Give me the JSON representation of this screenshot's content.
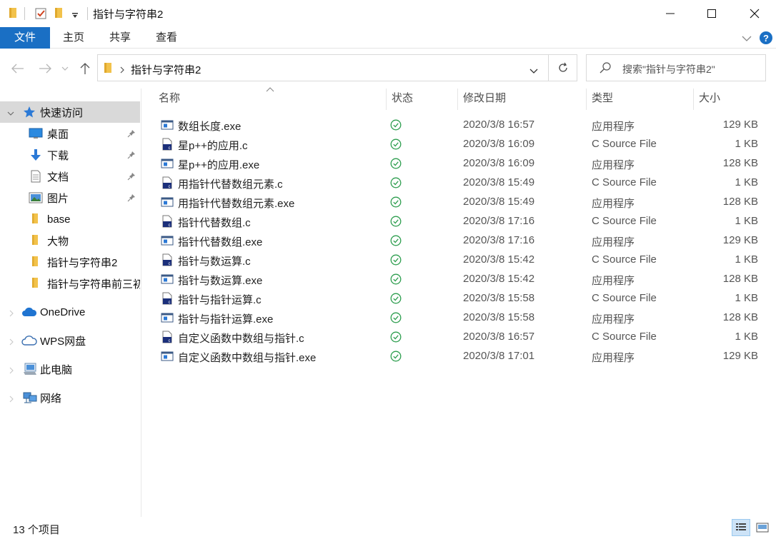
{
  "window": {
    "title": "指针与字符串2"
  },
  "ribbon": {
    "tabs": [
      {
        "label": "文件",
        "active": true
      },
      {
        "label": "主页",
        "active": false
      },
      {
        "label": "共享",
        "active": false
      },
      {
        "label": "查看",
        "active": false
      }
    ]
  },
  "address": {
    "path": "指针与字符串2",
    "search_placeholder": "搜索\"指针与字符串2\""
  },
  "sidebar": {
    "items": [
      {
        "label": "快速访问",
        "icon": "star-icon",
        "pinned": false,
        "selected": true
      },
      {
        "label": "桌面",
        "icon": "desktop-icon",
        "pinned": true
      },
      {
        "label": "下载",
        "icon": "download-icon",
        "pinned": true
      },
      {
        "label": "文档",
        "icon": "document-icon",
        "pinned": true
      },
      {
        "label": "图片",
        "icon": "picture-icon",
        "pinned": true
      },
      {
        "label": "base",
        "icon": "folder-icon",
        "pinned": false
      },
      {
        "label": "大物",
        "icon": "folder-icon",
        "pinned": false
      },
      {
        "label": "指针与字符串2",
        "icon": "folder-icon",
        "pinned": false
      },
      {
        "label": "指针与字符串前三初",
        "icon": "folder-icon",
        "pinned": false
      },
      {
        "label": "OneDrive",
        "icon": "cloud-icon",
        "pinned": false
      },
      {
        "label": "WPS网盘",
        "icon": "wps-cloud-icon",
        "pinned": false
      },
      {
        "label": "此电脑",
        "icon": "computer-icon",
        "pinned": false
      },
      {
        "label": "网络",
        "icon": "network-icon",
        "pinned": false
      }
    ]
  },
  "columns": {
    "name": "名称",
    "status": "状态",
    "modified": "修改日期",
    "type": "类型",
    "size": "大小"
  },
  "files": [
    {
      "name": "数组长度.exe",
      "kind": "exe",
      "date": "2020/3/8 16:57",
      "type": "应用程序",
      "size": "129 KB"
    },
    {
      "name": "星p++的应用.c",
      "kind": "c",
      "date": "2020/3/8 16:09",
      "type": "C Source File",
      "size": "1 KB"
    },
    {
      "name": "星p++的应用.exe",
      "kind": "exe",
      "date": "2020/3/8 16:09",
      "type": "应用程序",
      "size": "128 KB"
    },
    {
      "name": "用指针代替数组元素.c",
      "kind": "c",
      "date": "2020/3/8 15:49",
      "type": "C Source File",
      "size": "1 KB"
    },
    {
      "name": "用指针代替数组元素.exe",
      "kind": "exe",
      "date": "2020/3/8 15:49",
      "type": "应用程序",
      "size": "128 KB"
    },
    {
      "name": "指针代替数组.c",
      "kind": "c",
      "date": "2020/3/8 17:16",
      "type": "C Source File",
      "size": "1 KB"
    },
    {
      "name": "指针代替数组.exe",
      "kind": "exe",
      "date": "2020/3/8 17:16",
      "type": "应用程序",
      "size": "129 KB"
    },
    {
      "name": "指针与数运算.c",
      "kind": "c",
      "date": "2020/3/8 15:42",
      "type": "C Source File",
      "size": "1 KB"
    },
    {
      "name": "指针与数运算.exe",
      "kind": "exe",
      "date": "2020/3/8 15:42",
      "type": "应用程序",
      "size": "128 KB"
    },
    {
      "name": "指针与指针运算.c",
      "kind": "c",
      "date": "2020/3/8 15:58",
      "type": "C Source File",
      "size": "1 KB"
    },
    {
      "name": "指针与指针运算.exe",
      "kind": "exe",
      "date": "2020/3/8 15:58",
      "type": "应用程序",
      "size": "128 KB"
    },
    {
      "name": "自定义函数中数组与指针.c",
      "kind": "c",
      "date": "2020/3/8 16:57",
      "type": "C Source File",
      "size": "1 KB"
    },
    {
      "name": "自定义函数中数组与指针.exe",
      "kind": "exe",
      "date": "2020/3/8 17:01",
      "type": "应用程序",
      "size": "129 KB"
    }
  ],
  "status": {
    "count_text": "13 个项目"
  },
  "colors": {
    "accent": "#1a6fc4",
    "sync_ok": "#2e9e4f",
    "folder": "#f2c24b"
  }
}
